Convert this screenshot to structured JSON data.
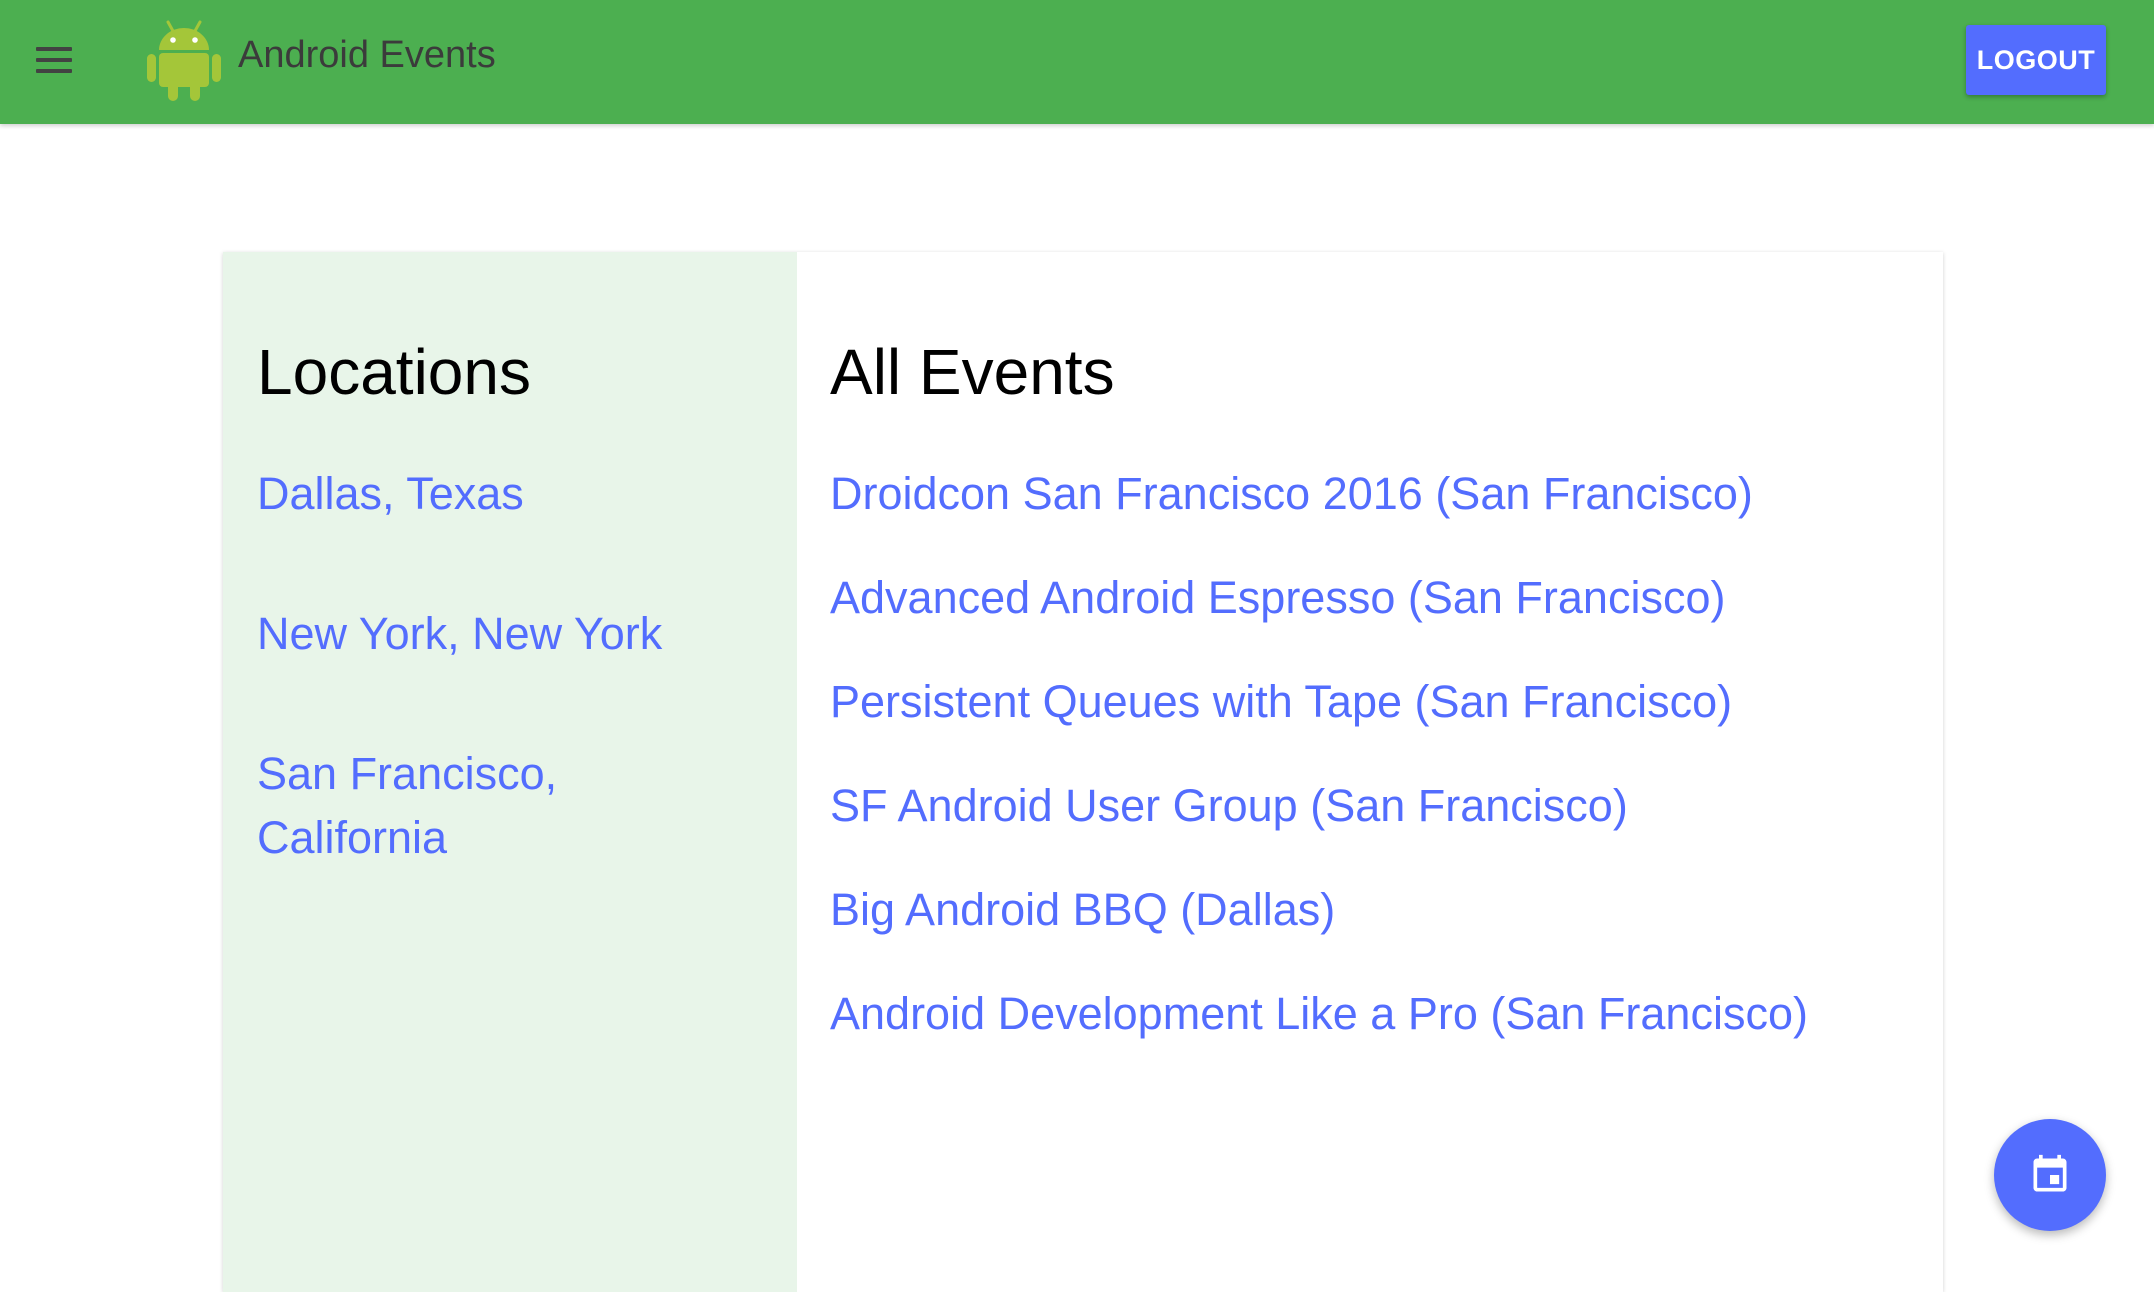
{
  "app_bar": {
    "title": "Android Events",
    "menu_icon": "hamburger-menu-icon",
    "logo_icon": "android-robot-icon",
    "logout_label": "LOGOUT",
    "color": "#4caf50"
  },
  "locations": {
    "title": "Locations",
    "items": [
      "Dallas, Texas",
      "New York, New York",
      "San Francisco, California"
    ]
  },
  "events": {
    "title": "All Events",
    "items": [
      "Droidcon San Francisco 2016 (San Francisco)",
      "Advanced Android Espresso (San Francisco)",
      "Persistent Queues with Tape (San Francisco)",
      "SF Android User Group (San Francisco)",
      "Big Android BBQ (Dallas)",
      "Android Development Like a Pro (San Francisco)"
    ]
  },
  "fab": {
    "icon": "calendar-event-icon"
  },
  "colors": {
    "accent": "#536dfe",
    "sidebar_background": "#e8f5e9",
    "android_green": "#a4c639"
  }
}
